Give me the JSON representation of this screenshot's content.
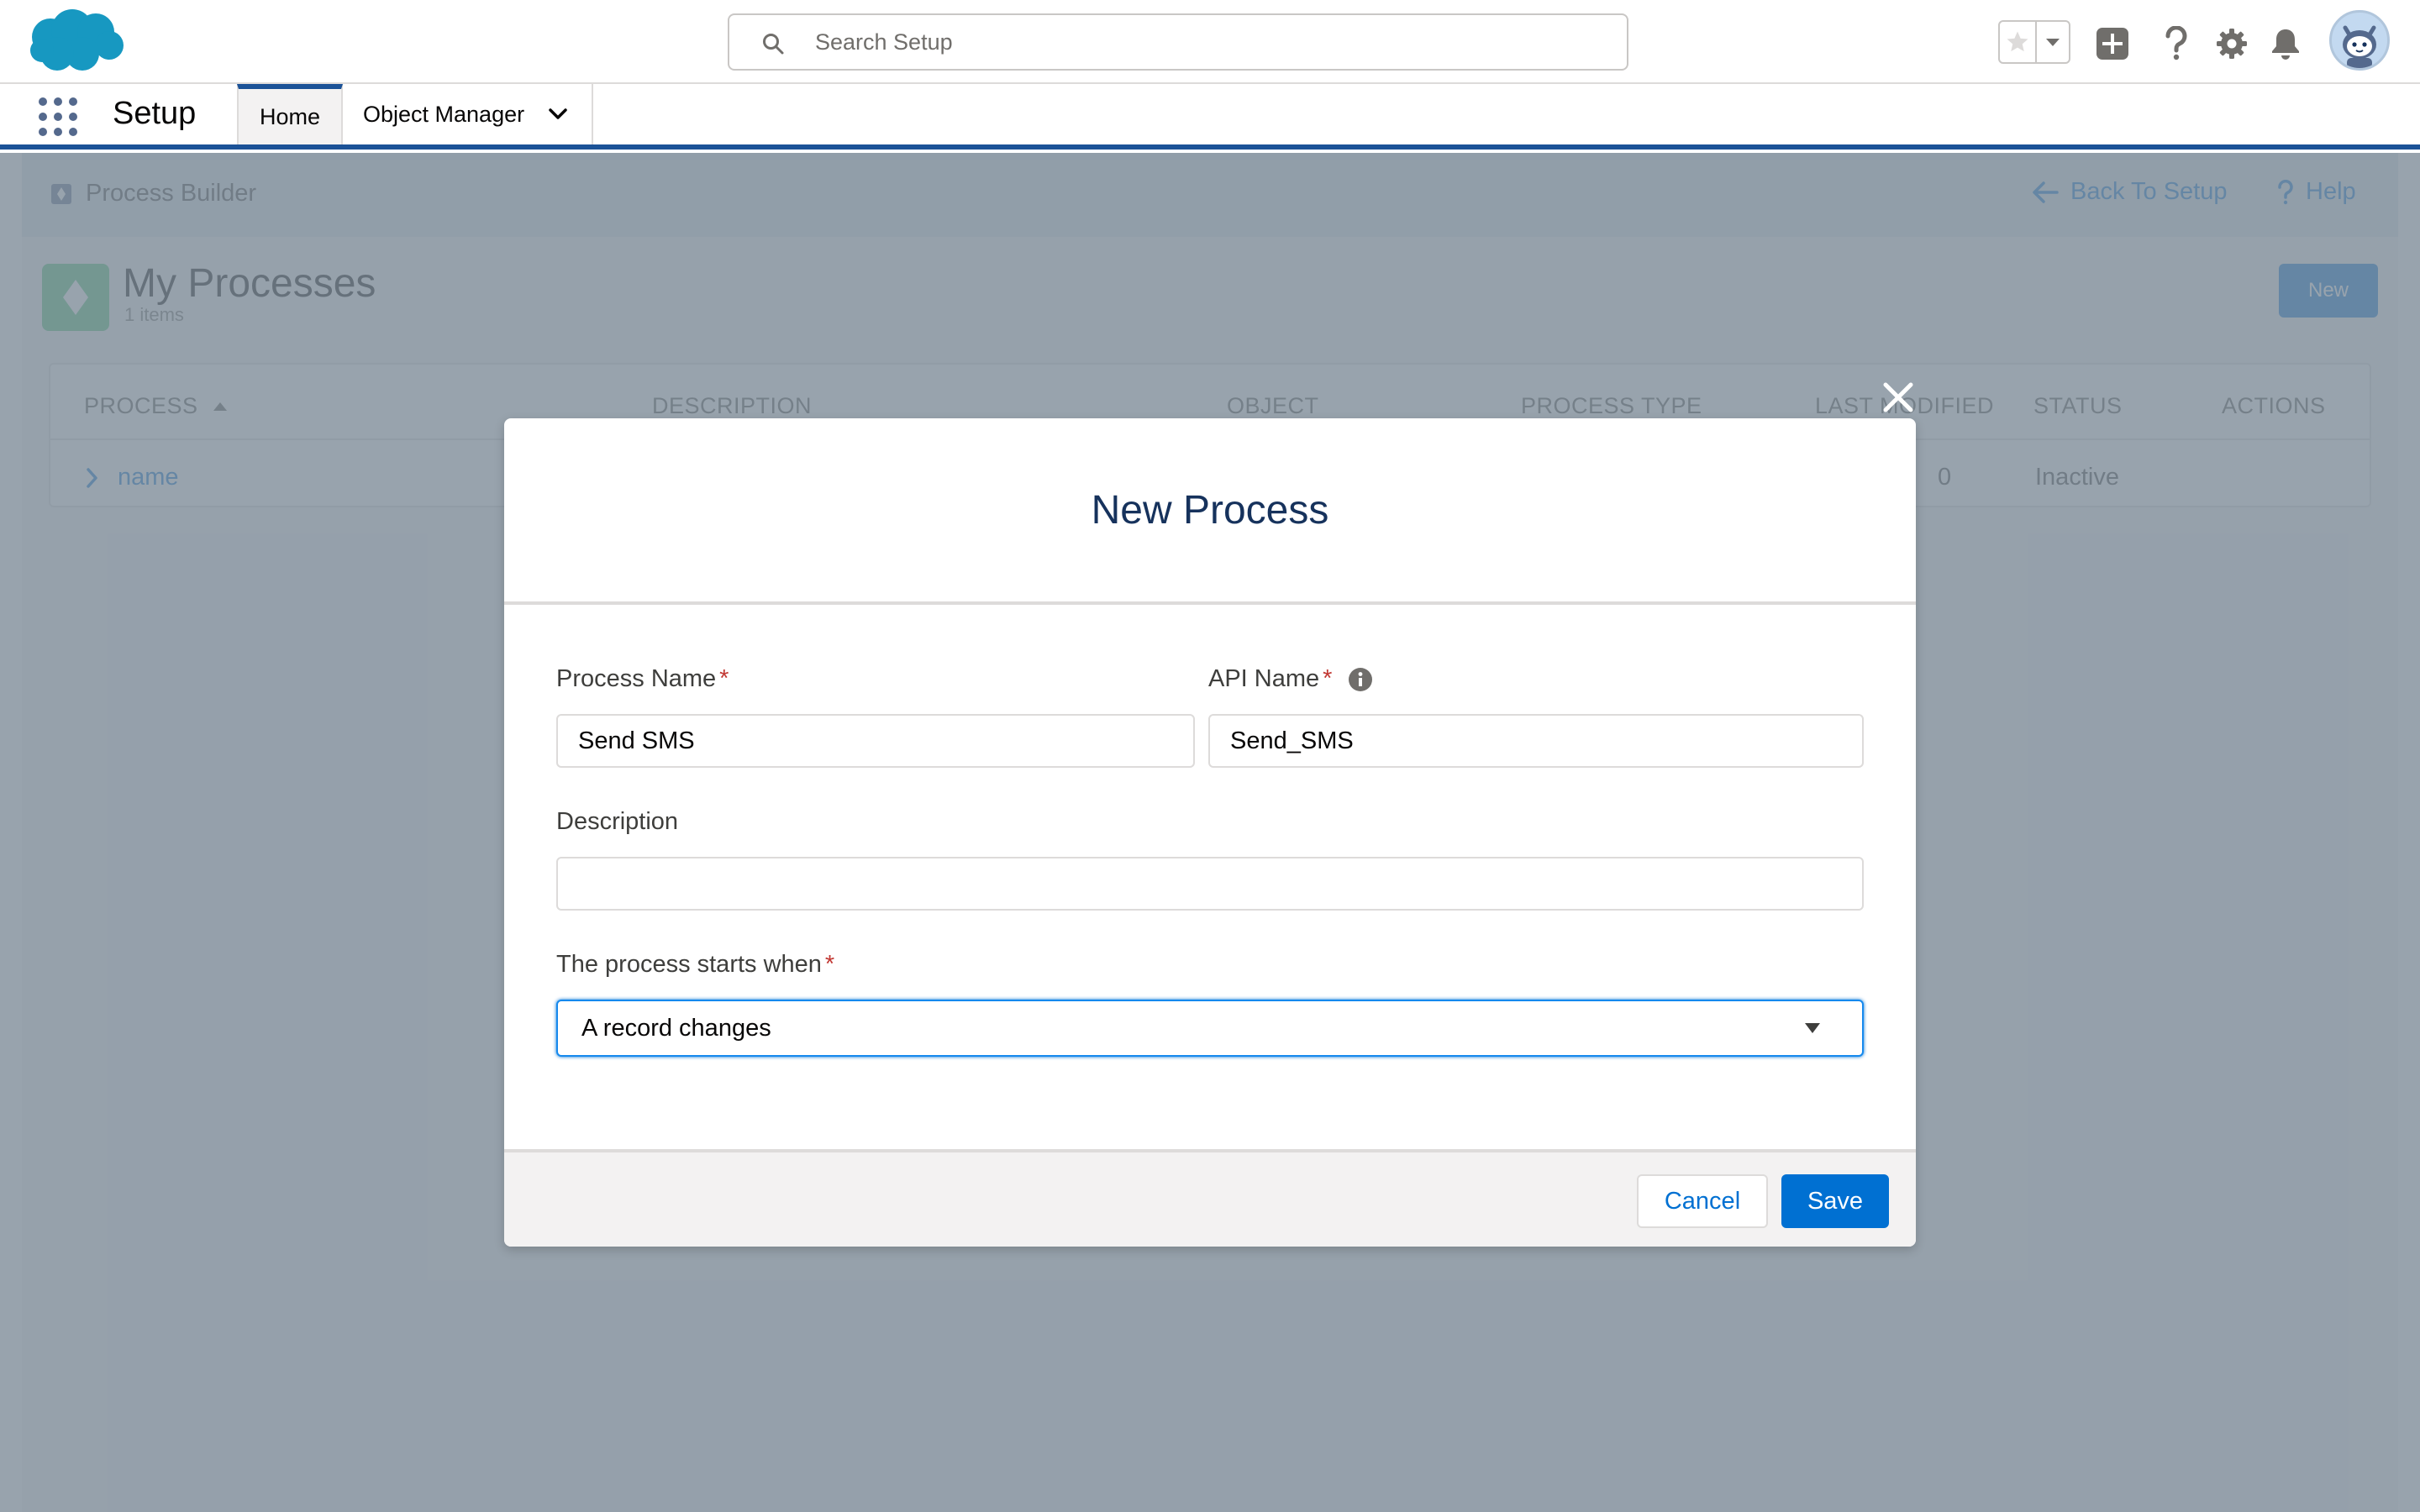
{
  "header": {
    "search_placeholder": "Search Setup",
    "icons": [
      "salesforce-logo",
      "favorites-star-icon",
      "chevron-down-icon",
      "add-icon",
      "help-icon",
      "setup-gear-icon",
      "notifications-bell-icon",
      "avatar"
    ]
  },
  "context_bar": {
    "app_name": "Setup",
    "tabs": [
      {
        "label": "Home",
        "active": true
      },
      {
        "label": "Object Manager",
        "active": false
      }
    ]
  },
  "process_builder": {
    "header_title": "Process Builder",
    "back_label": "Back To Setup",
    "help_label": "Help",
    "list_title": "My Processes",
    "item_count": "1 items",
    "new_label": "New",
    "columns": [
      "PROCESS",
      "DESCRIPTION",
      "OBJECT",
      "PROCESS TYPE",
      "LAST MODIFIED",
      "STATUS",
      "ACTIONS"
    ],
    "rows": [
      {
        "process": "name",
        "last_modified_fragment": "0",
        "status": "Inactive"
      }
    ]
  },
  "modal": {
    "title": "New Process",
    "process_name_label": "Process Name",
    "process_name_value": "Send SMS",
    "api_name_label": "API Name",
    "api_name_value": "Send_SMS",
    "description_label": "Description",
    "description_value": "",
    "starts_when_label": "The process starts when",
    "starts_when_value": "A record changes",
    "required_marker": "*",
    "cancel_label": "Cancel",
    "save_label": "Save"
  },
  "colors": {
    "brand": "#0070d2",
    "context_bar_accent": "#1b5297",
    "modal_title": "#16325c",
    "required": "#c23934",
    "overlay": "rgba(126,140,153,0.8)"
  }
}
